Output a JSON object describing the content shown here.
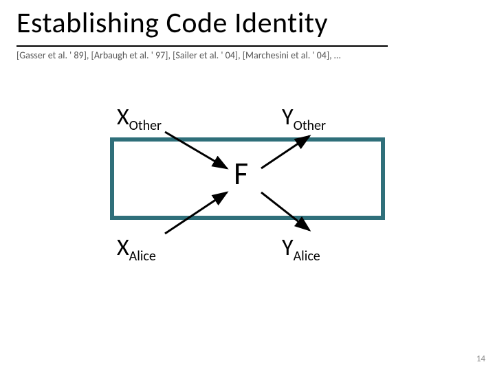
{
  "title": "Establishing Code Identity",
  "citations": "[Gasser et al. ' 89], [Arbaugh et al. ' 97], [Sailer et al. ' 04], [Marchesini et al. ' 04], …",
  "diagram": {
    "top_left_base": "X",
    "top_left_sub": "Other",
    "top_right_base": "Y",
    "top_right_sub": "Other",
    "bottom_left_base": "X",
    "bottom_left_sub": "Alice",
    "bottom_right_base": "Y",
    "bottom_right_sub": "Alice",
    "center": "F"
  },
  "page_number": "14"
}
